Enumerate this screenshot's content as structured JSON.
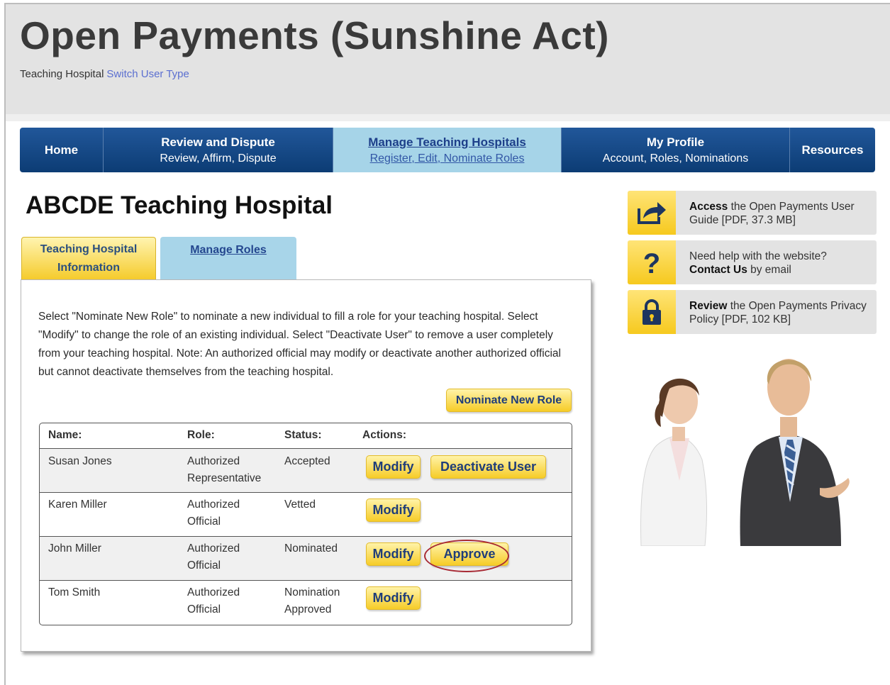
{
  "header": {
    "title": "Open Payments (Sunshine Act)",
    "user_type": "Teaching Hospital",
    "switch_link": "Switch User Type"
  },
  "nav": {
    "home": "Home",
    "review_title": "Review and Dispute",
    "review_sub": "Review, Affirm, Dispute",
    "manage_title": "Manage Teaching Hospitals",
    "manage_sub": "Register, Edit, Nominate Roles",
    "profile_title": "My Profile",
    "profile_sub": "Account, Roles, Nominations",
    "resources": "Resources"
  },
  "main": {
    "hospital_name": "ABCDE Teaching Hospital",
    "tabs": {
      "info_line1": "Teaching Hospital",
      "info_line2": "Information",
      "roles": "Manage Roles"
    },
    "intro": "Select \"Nominate New Role\" to nominate a new individual to fill a role for your teaching hospital. Select \"Modify\" to change the role of an existing individual. Select \"Deactivate User\" to remove a user completely from your teaching hospital. Note: An authorized official may modify or deactivate another authorized official but cannot deactivate themselves from the teaching hospital.",
    "nominate_button": "Nominate New Role",
    "table": {
      "headers": [
        "Name:",
        "Role:",
        "Status:",
        "Actions:"
      ],
      "rows": [
        {
          "name": "Susan Jones",
          "role1": "Authorized",
          "role2": "Representative",
          "status1": "Accepted",
          "status2": "",
          "modify": "Modify",
          "extra": "Deactivate User"
        },
        {
          "name": "Karen Miller",
          "role1": "Authorized",
          "role2": "Official",
          "status1": "Vetted",
          "status2": "",
          "modify": "Modify",
          "extra": ""
        },
        {
          "name": "John Miller",
          "role1": "Authorized",
          "role2": "Official",
          "status1": "Nominated",
          "status2": "",
          "modify": "Modify",
          "extra": "Approve"
        },
        {
          "name": "Tom Smith",
          "role1": "Authorized",
          "role2": "Official",
          "status1": "Nomination",
          "status2": "Approved",
          "modify": "Modify",
          "extra": ""
        }
      ]
    }
  },
  "sidebar": {
    "guide_bold": "Access",
    "guide_text": " the Open Payments User Guide [PDF, 37.3 MB]",
    "help_text": "Need help with the website?",
    "help_bold": "Contact Us",
    "help_text2": " by email",
    "privacy_bold": "Review",
    "privacy_text": " the Open Payments Privacy Policy [PDF, 102 KB]",
    "icons": [
      "share-arrow-icon",
      "question-mark-icon",
      "lock-icon"
    ],
    "icon_color": "#f6c91e"
  }
}
